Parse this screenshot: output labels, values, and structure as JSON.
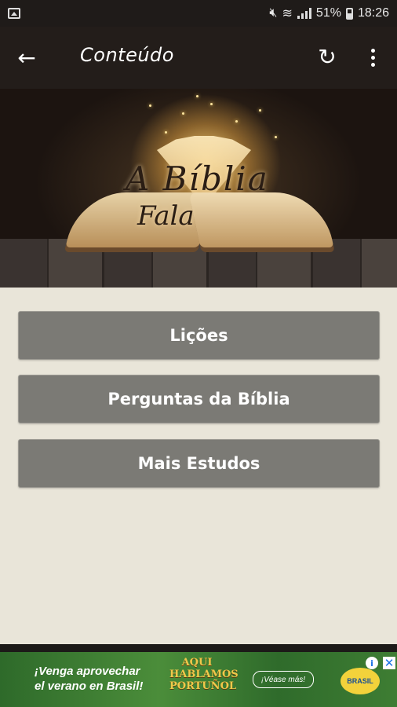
{
  "status_bar": {
    "battery": "51%",
    "time": "18:26",
    "icons": [
      "image-icon",
      "mute-icon",
      "wifi-icon",
      "signal-icon",
      "battery-icon"
    ]
  },
  "app_bar": {
    "title": "Conteúdo",
    "back_icon": "arrow-back-icon",
    "refresh_icon": "refresh-icon",
    "menu_icon": "more-vert-icon"
  },
  "banner": {
    "line1": "A Bíblia",
    "line2": "Fala"
  },
  "menu_buttons": [
    {
      "label": "Lições"
    },
    {
      "label": "Perguntas da Bíblia"
    },
    {
      "label": "Mais Estudos"
    }
  ],
  "ad": {
    "text_line1": "¡Venga aprovechar",
    "text_line2": "el verano en Brasil!",
    "logo_line1": "AQUI",
    "logo_line2": "HABLAMOS",
    "logo_line3": "PORTUÑOL",
    "cta": "¡Véase más!",
    "brand": "BRASIL",
    "info": "i",
    "close": "✕"
  },
  "colors": {
    "status_bar": "#1f1b19",
    "app_bar": "#231d1a",
    "background": "#e9e5d9",
    "button": "#7b7a75"
  }
}
